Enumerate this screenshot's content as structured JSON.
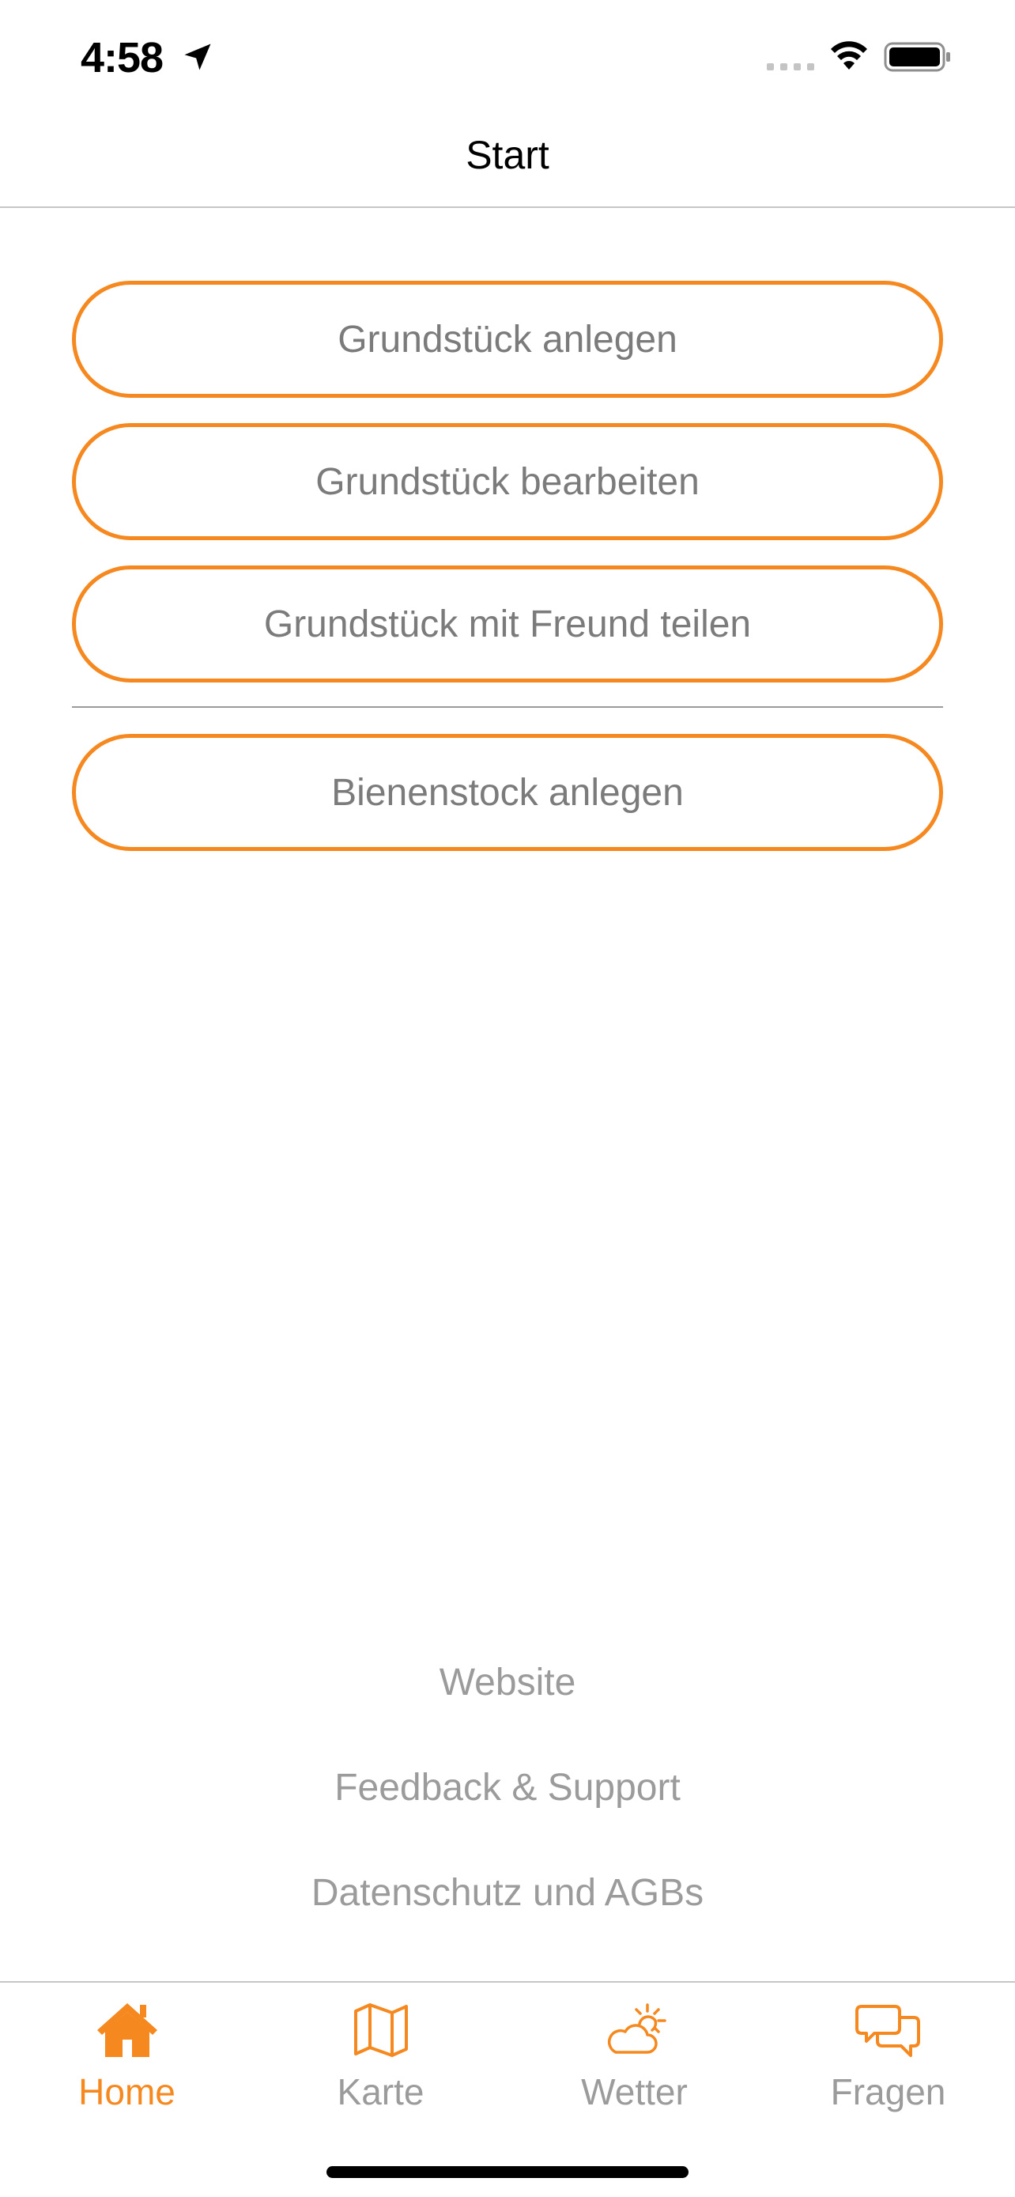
{
  "status_bar": {
    "time": "4:58"
  },
  "nav": {
    "title": "Start"
  },
  "buttons": {
    "create_property": "Grundstück anlegen",
    "edit_property": "Grundstück bearbeiten",
    "share_property": "Grundstück mit Freund teilen",
    "create_hive": "Bienenstock anlegen"
  },
  "footer": {
    "website": "Website",
    "feedback": "Feedback & Support",
    "privacy": "Datenschutz und AGBs"
  },
  "tabs": [
    {
      "label": "Home",
      "icon": "house-icon",
      "selected": true
    },
    {
      "label": "Karte",
      "icon": "map-icon",
      "selected": false
    },
    {
      "label": "Wetter",
      "icon": "weather-icon",
      "selected": false
    },
    {
      "label": "Fragen",
      "icon": "chat-bubbles-icon",
      "selected": false
    }
  ],
  "colors": {
    "accent": "#f5881e",
    "button_text": "#7b7b7b",
    "inactive": "#9b9b9b",
    "divider": "#c6c6c8"
  }
}
